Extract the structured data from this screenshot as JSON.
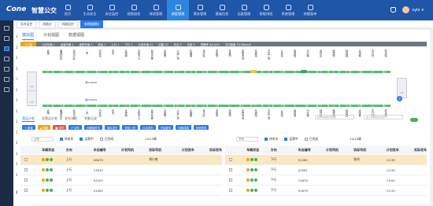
{
  "app": {
    "logo": "Cone",
    "name": "智慧公交"
  },
  "nav": [
    "首页",
    "生动安全",
    "安全监控",
    "视频巡检",
    "排班管理",
    "调度管理",
    "票务管理",
    "基础信息",
    "运维管理",
    "智能排班",
    "系统管理",
    "快捷菜单"
  ],
  "nav_active": 5,
  "user": {
    "name": "sylo"
  },
  "tabs": [
    "实时监控",
    "线路台",
    "线路监控",
    "非线路模拟"
  ],
  "tab_active": 3,
  "route_labels": [
    "102路",
    "103路",
    "105路",
    "106路",
    "107路",
    "108路",
    "110路",
    "111路",
    "113路",
    "115路",
    "116路",
    "117路",
    "118路",
    "119路"
  ],
  "route_active": "107路",
  "footer": "备用车",
  "subtabs": [
    "模拟图",
    "计划视图",
    "数据视图"
  ],
  "statbar": {
    "chip": "107路",
    "items": [
      "计划车辆 1",
      "运营车辆 1",
      "维修车辆 1",
      "停运 1",
      "上行 1",
      "下行 1",
      "计划车辆 31",
      "回路 10",
      "车站 3",
      "车距 9",
      "预警率 44.44%",
      "平均速度 33.50km/h"
    ]
  },
  "upper_stations": [
    "北湖",
    "南湖社区",
    "北北小区",
    "二中",
    "汽车站",
    "东关",
    "大桥南",
    "文化中心",
    "百货大楼",
    "中医院",
    "人民广场",
    "红旗路",
    "军分区",
    "市政府",
    "车管所",
    "农贸市场",
    "长途站",
    "万达广场",
    "火车站",
    "体育馆",
    "白沙路",
    "经开区",
    "医学院",
    "科技园",
    "大学城",
    "东门村",
    "终点站"
  ],
  "lower_stations": [
    "北湖",
    "南湖社区",
    "北北小区",
    "二中",
    "汽车站",
    "东关",
    "大桥南",
    "文化中心",
    "百货大楼",
    "中医院",
    "人民广场",
    "红旗路",
    "军分区",
    "市政府",
    "车管所",
    "农贸市场",
    "长途站",
    "万达广场",
    "火车站",
    "体育馆",
    "白沙路",
    "经开区",
    "医学院",
    "科技园",
    "大学城",
    "东门村",
    "终点站"
  ],
  "route_tags": {
    "upper": "鄂D18008",
    "lower": "鄂D18008"
  },
  "terminal_label": "(P)",
  "marker": "2",
  "lowtabs": [
    "营运计划",
    "非营运计划",
    "发车计划",
    "考勤记录"
  ],
  "search_placeholders": [
    "输入车辆编号搜索",
    "输入车辆编号搜索"
  ],
  "buttons": [
    {
      "label": "+ 新增",
      "color": "#2c7be5"
    },
    {
      "label": "▲ 调度",
      "color": "#f2a413"
    },
    {
      "label": "■ 发车",
      "color": "#e4574c"
    },
    {
      "label": "⟳ 加车",
      "color": "#2c7be5"
    },
    {
      "label": "设置临时车",
      "color": "#2c7be5"
    },
    {
      "label": "插队发车",
      "color": "#2c7be5"
    },
    {
      "label": "恢复上班",
      "color": "#2c7be5"
    },
    {
      "label": "补点发车",
      "color": "#2c7be5"
    },
    {
      "label": "不运营车",
      "color": "#2c7be5"
    },
    {
      "label": "切换线路",
      "color": "#2c7be5"
    },
    {
      "label": "排班修改",
      "color": "#2c7be5"
    }
  ],
  "panels": [
    {
      "direction": "上行",
      "checks": [
        {
          "label": "待发车",
          "on": true
        },
        {
          "label": "运营中",
          "on": true
        },
        {
          "label": "已完成",
          "on": false
        }
      ],
      "count": "10/10辆",
      "headers": [
        "",
        "车辆状态",
        "方向",
        "车自编号",
        "计划司机",
        "实际司机",
        "计划发车",
        "实际发车"
      ],
      "rows": [
        {
          "dir": "上行",
          "no": "06079",
          "plan": "",
          "actual": "郑小南",
          "pt": "",
          "at": "",
          "hl": true
        },
        {
          "dir": "上行",
          "no": "13532",
          "plan": "",
          "actual": "",
          "pt": "",
          "at": "",
          "hl": false
        },
        {
          "dir": "上行",
          "no": "02102",
          "plan": "",
          "actual": "",
          "pt": "",
          "at": "",
          "hl": false
        },
        {
          "dir": "上行",
          "no": "01262",
          "plan": "",
          "actual": "",
          "pt": "",
          "at": "",
          "hl": false
        }
      ]
    },
    {
      "direction": "下行",
      "checks": [
        {
          "label": "待发车",
          "on": true
        },
        {
          "label": "运营中",
          "on": true
        },
        {
          "label": "已完成",
          "on": false
        }
      ],
      "count": "10/10辆",
      "headers": [
        "",
        "车辆状态",
        "方向",
        "车自编号",
        "计划司机",
        "实际司机",
        "计划发车",
        "实际发车"
      ],
      "rows": [
        {
          "dir": "下行",
          "no": "01262",
          "plan": "",
          "actual": "陈四",
          "pt": "12:30",
          "at": "",
          "hl": true
        },
        {
          "dir": "下行",
          "no": "01061",
          "plan": "",
          "actual": "",
          "pt": "12:40",
          "at": "",
          "hl": false
        },
        {
          "dir": "下行",
          "no": "11875",
          "plan": "",
          "actual": "",
          "pt": "13:00",
          "at": "",
          "hl": false
        },
        {
          "dir": "下行",
          "no": "01875",
          "plan": "",
          "actual": "",
          "pt": "13:10",
          "at": "",
          "hl": false
        }
      ]
    }
  ]
}
